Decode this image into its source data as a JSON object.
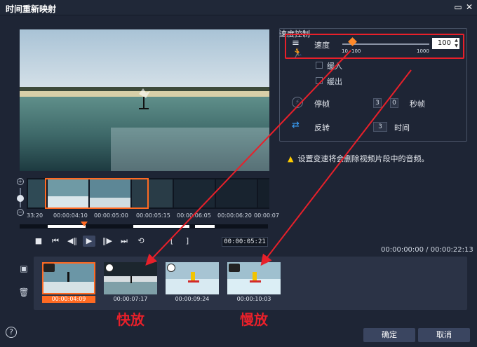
{
  "window": {
    "title": "时间重新映射"
  },
  "filmstrip": {
    "timecodes": [
      "33:20",
      "00:00:04:10",
      "00:00:05:00",
      "00:00:05:15",
      "00:00:06:05",
      "00:00:06:20",
      "00:00:07"
    ]
  },
  "playback": {
    "current_time": "00:00:05:21",
    "total": "00:00:00:00 / 00:00:22:13",
    "progress_percent": 26
  },
  "speed_group": {
    "legend": "速度控制",
    "speed_label": "速度",
    "speed_value": "100",
    "slider_ticks": [
      "10",
      "100",
      "1000"
    ],
    "ease_in": "缓入",
    "ease_out": "缓出",
    "freeze_label": "停帧",
    "freeze_value_1": "3",
    "freeze_value_2": "0",
    "freeze_unit": "秒帧",
    "reverse_label": "反转",
    "reverse_value": "3",
    "reverse_unit": "时间"
  },
  "warning": "设置变速将会删除视频片段中的音频。",
  "clips": [
    {
      "time": "00:00:04:09",
      "selected": true
    },
    {
      "time": "00:00:07:17",
      "selected": false
    },
    {
      "time": "00:00:09:24",
      "selected": false
    },
    {
      "time": "00:00:10:03",
      "selected": false
    }
  ],
  "annotations": {
    "fast": "快放",
    "slow": "慢放"
  },
  "buttons": {
    "ok": "确定",
    "cancel": "取消"
  },
  "colors": {
    "accent": "#ff6a22",
    "annotation_red": "#e8202a",
    "background": "#1e2535"
  }
}
